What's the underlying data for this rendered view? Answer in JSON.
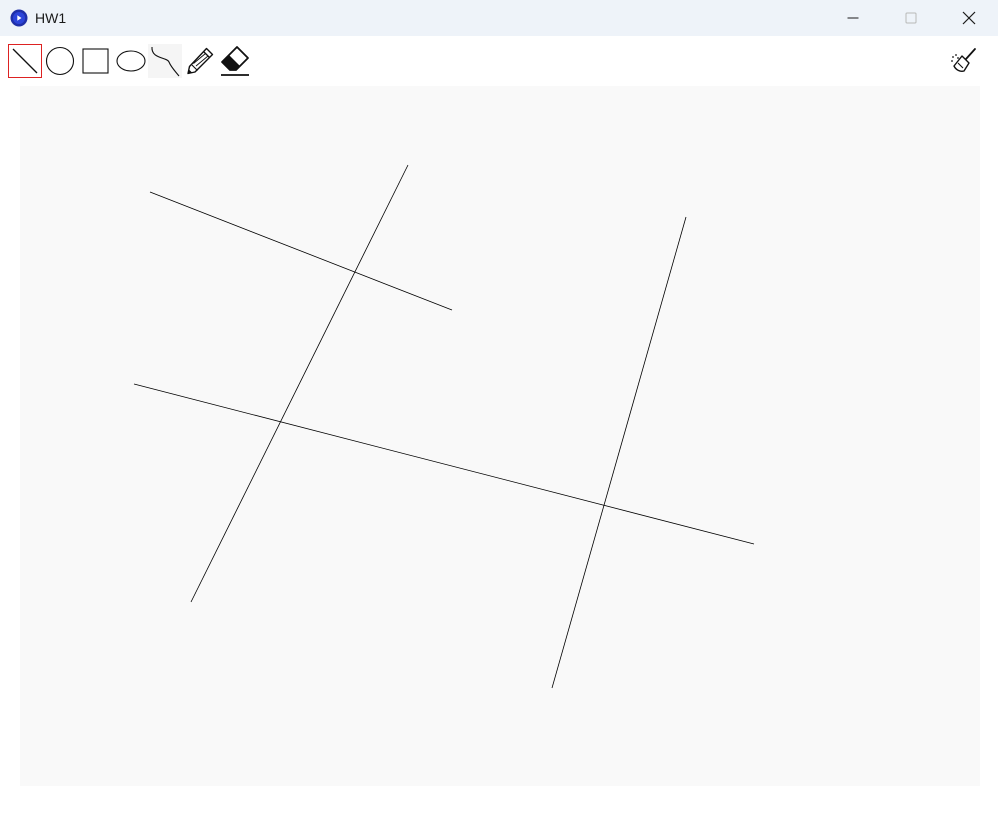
{
  "window": {
    "title": "HW1",
    "app_icon": "app-icon",
    "controls": [
      "minimize-icon",
      "maximize-icon",
      "close-icon"
    ]
  },
  "toolbar": {
    "tools": [
      {
        "id": "line",
        "icon": "line-icon",
        "selected": true
      },
      {
        "id": "circle",
        "icon": "circle-icon",
        "selected": false
      },
      {
        "id": "rectangle",
        "icon": "rectangle-icon",
        "selected": false
      },
      {
        "id": "ellipse",
        "icon": "ellipse-icon",
        "selected": false
      },
      {
        "id": "curve",
        "icon": "curve-icon",
        "selected": false
      },
      {
        "id": "pencil",
        "icon": "pencil-icon",
        "selected": false
      },
      {
        "id": "eraser",
        "icon": "eraser-icon",
        "selected": false
      }
    ],
    "clear_icon": "broom-icon",
    "selected_color": "#dd2222"
  },
  "canvas": {
    "background": "#f9f9f9",
    "stroke_color": "#000000",
    "shapes": [
      {
        "type": "line"
      },
      {
        "type": "line"
      },
      {
        "type": "line"
      },
      {
        "type": "line"
      }
    ]
  }
}
